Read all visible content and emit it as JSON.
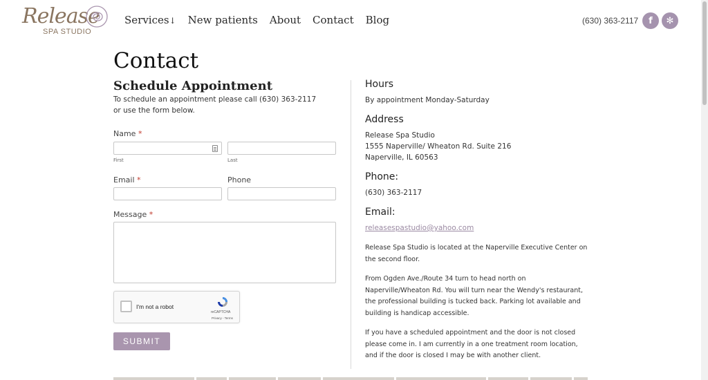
{
  "header": {
    "logo": {
      "script": "Release",
      "sub": "SPA STUDIO"
    },
    "nav": [
      {
        "label": "Services",
        "arrow": "↓"
      },
      {
        "label": "New patients"
      },
      {
        "label": "About"
      },
      {
        "label": "Contact"
      },
      {
        "label": "Blog"
      }
    ],
    "phone": "(630) 363-2117",
    "social": {
      "facebook": "f",
      "yelp": "✻"
    }
  },
  "page": {
    "title": "Contact"
  },
  "form": {
    "title": "Schedule Appointment",
    "intro_line1": "To schedule an appointment please call (630) 363-2117",
    "intro_line2": "or use the form below.",
    "name_label": "Name",
    "required_mark": "*",
    "first_sublabel": "First",
    "last_sublabel": "Last",
    "email_label": "Email",
    "phone_label": "Phone",
    "message_label": "Message",
    "recaptcha": {
      "label": "I'm not a robot",
      "brand": "reCAPTCHA",
      "terms": "Privacy - Terms"
    },
    "submit_label": "SUBMIT"
  },
  "info": {
    "hours_heading": "Hours",
    "hours_text": "By appointment Monday-Saturday",
    "address_heading": "Address",
    "address_line1": "Release Spa Studio",
    "address_line2": "1555 Naperville/ Wheaton Rd. Suite 216",
    "address_line3": "Naperville, IL 60563",
    "phone_heading": "Phone:",
    "phone_text": "(630) 363-2117",
    "email_heading": "Email:",
    "email_text": "releasespastudio@yahoo.com",
    "para1": "Release Spa Studio is located at the Naperville Executive Center on the second floor.",
    "para2": "From Ogden Ave./Route 34 turn to head north on Naperville/Wheaton Rd. You will turn near the Wendy's restaurant, the professional building is tucked back. Parking lot available and building is handicap accessible.",
    "para3": "If you have a scheduled appointment and the door is not closed please come in. I am currently in a one treatment room location, and if the door is closed I may be with another client."
  },
  "colors": {
    "accent": "#a995ae",
    "logo": "#8a7560",
    "required": "#c0392b",
    "link": "#9b8aa3"
  }
}
